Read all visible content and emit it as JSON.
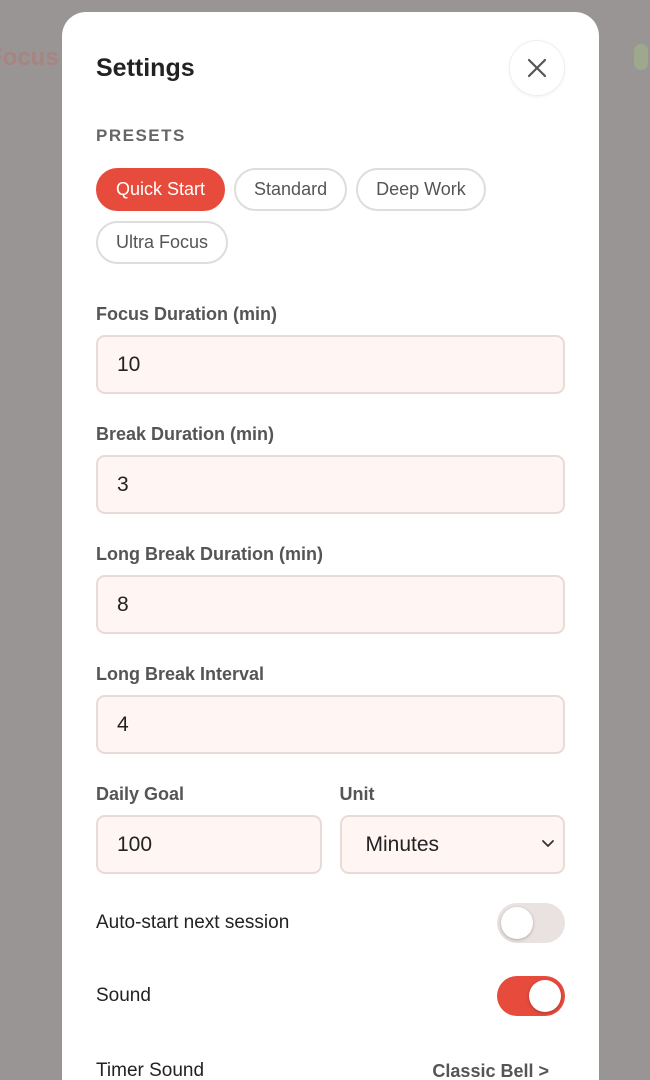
{
  "background": {
    "app_title_fragment": "Focus",
    "accent_color": "#e64b3c"
  },
  "modal": {
    "title": "Settings",
    "close_icon": "close-icon"
  },
  "presets": {
    "label": "PRESETS",
    "items": [
      {
        "label": "Quick Start",
        "active": true
      },
      {
        "label": "Standard",
        "active": false
      },
      {
        "label": "Deep Work",
        "active": false
      },
      {
        "label": "Ultra Focus",
        "active": false
      }
    ]
  },
  "fields": {
    "focus_duration": {
      "label": "Focus Duration (min)",
      "value": "10"
    },
    "break_duration": {
      "label": "Break Duration (min)",
      "value": "3"
    },
    "long_break_duration": {
      "label": "Long Break Duration (min)",
      "value": "8"
    },
    "long_break_interval": {
      "label": "Long Break Interval",
      "value": "4"
    },
    "daily_goal": {
      "label": "Daily Goal",
      "value": "100"
    },
    "unit": {
      "label": "Unit",
      "selected": "Minutes"
    }
  },
  "toggles": {
    "auto_start": {
      "label": "Auto-start next session",
      "on": false
    },
    "sound": {
      "label": "Sound",
      "on": true
    }
  },
  "timer_sound": {
    "label": "Timer Sound",
    "value": "Classic Bell >"
  }
}
